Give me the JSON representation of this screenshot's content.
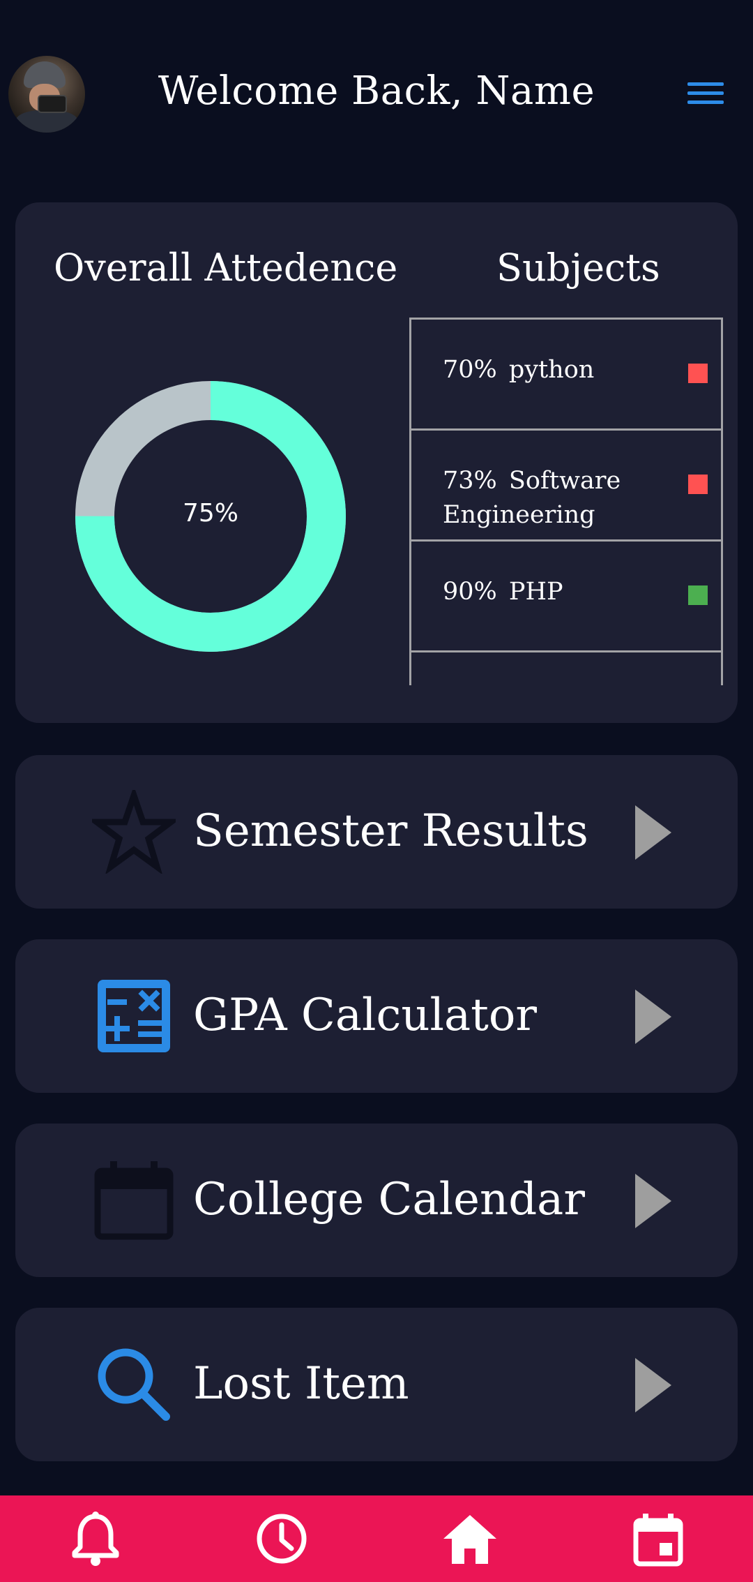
{
  "header": {
    "welcome": "Welcome Back, Name",
    "avatar_icon": "avatar-photo",
    "menu_icon": "hamburger-menu-icon"
  },
  "attendance": {
    "title": "Overall Attedence",
    "percent_label": "75%",
    "percent_value": 75,
    "colors": {
      "filled": "#64ffda",
      "remaining": "#b9c4c9"
    }
  },
  "subjects": {
    "title": "Subjects",
    "items": [
      {
        "text": "70%  python",
        "status_color": "#ff5252"
      },
      {
        "text": "73%  Software Engineering",
        "status_color": "#ff5252"
      },
      {
        "text": "90%  PHP",
        "status_color": "#4caf50"
      }
    ]
  },
  "actions": [
    {
      "label": "Semester Results",
      "icon": "star-icon"
    },
    {
      "label": "GPA Calculator",
      "icon": "calculator-icon"
    },
    {
      "label": "College Calendar",
      "icon": "calendar-icon"
    },
    {
      "label": "Lost Item",
      "icon": "search-icon"
    }
  ],
  "bottom_nav": {
    "background": "#eb1555",
    "items": [
      "notifications-bell-icon",
      "history-clock-icon",
      "home-icon",
      "event-calendar-icon"
    ]
  }
}
